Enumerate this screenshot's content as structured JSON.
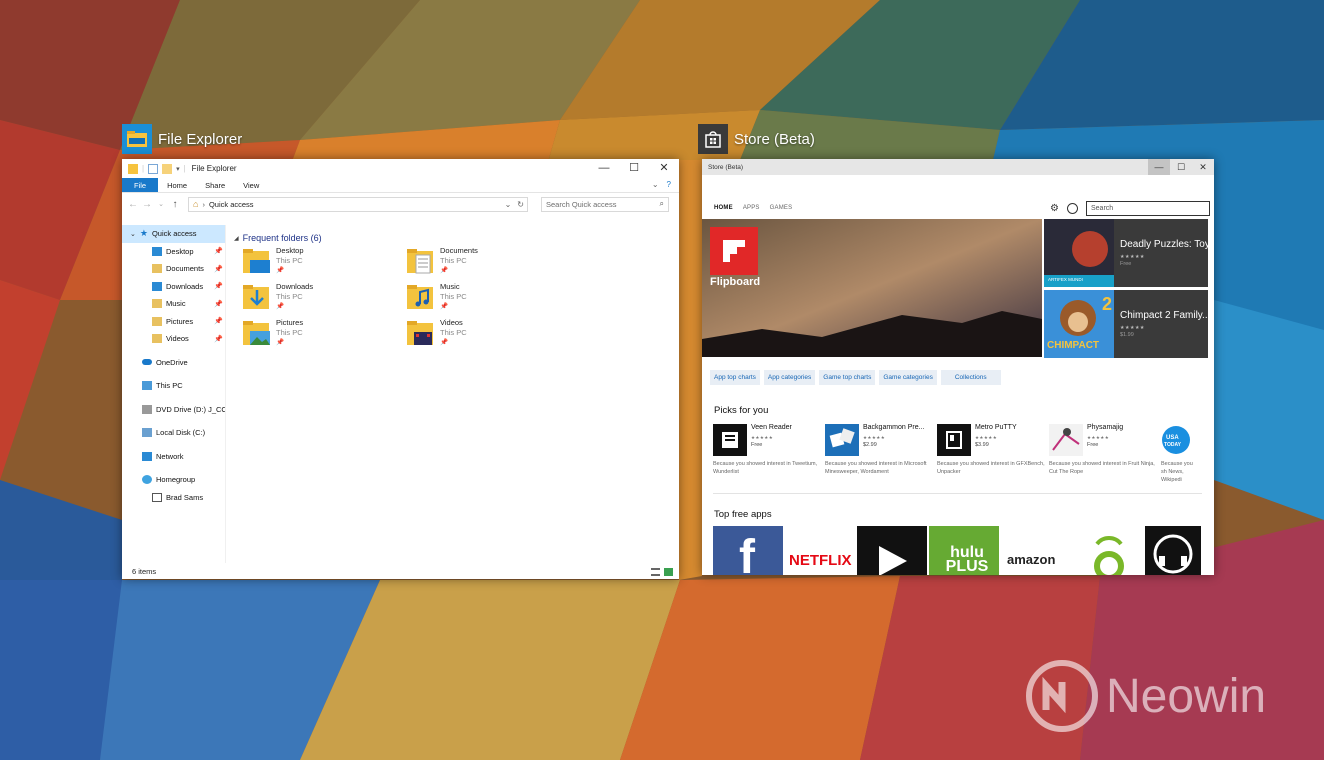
{
  "explorer": {
    "thumb_title": "File Explorer",
    "window_title": "File Explorer",
    "ribbon_tabs": [
      "File",
      "Home",
      "Share",
      "View"
    ],
    "address": "Quick access",
    "search_placeholder": "Search Quick access",
    "nav_items": [
      {
        "label": "Quick access",
        "icon": "star-icon",
        "pinned": false
      },
      {
        "label": "Desktop",
        "icon": "desktop-folder-icon",
        "pinned": true
      },
      {
        "label": "Documents",
        "icon": "documents-folder-icon",
        "pinned": true
      },
      {
        "label": "Downloads",
        "icon": "downloads-folder-icon",
        "pinned": true
      },
      {
        "label": "Music",
        "icon": "music-folder-icon",
        "pinned": true
      },
      {
        "label": "Pictures",
        "icon": "pictures-folder-icon",
        "pinned": true
      },
      {
        "label": "Videos",
        "icon": "videos-folder-icon",
        "pinned": true
      },
      {
        "label": "OneDrive",
        "icon": "onedrive-icon",
        "pinned": false
      },
      {
        "label": "This PC",
        "icon": "this-pc-icon",
        "pinned": false
      },
      {
        "label": "DVD Drive (D:) J_CCS",
        "icon": "dvd-drive-icon",
        "pinned": false
      },
      {
        "label": "Local Disk (C:)",
        "icon": "local-disk-icon",
        "pinned": false
      },
      {
        "label": "Network",
        "icon": "network-icon",
        "pinned": false
      },
      {
        "label": "Homegroup",
        "icon": "homegroup-icon",
        "pinned": false
      },
      {
        "label": "Brad Sams",
        "icon": "user-icon",
        "pinned": false
      }
    ],
    "group_title": "Frequent folders (6)",
    "folders": [
      {
        "name": "Desktop",
        "location": "This PC",
        "icon": "desktop"
      },
      {
        "name": "Documents",
        "location": "This PC",
        "icon": "documents"
      },
      {
        "name": "Downloads",
        "location": "This PC",
        "icon": "downloads"
      },
      {
        "name": "Music",
        "location": "This PC",
        "icon": "music"
      },
      {
        "name": "Pictures",
        "location": "This PC",
        "icon": "pictures"
      },
      {
        "name": "Videos",
        "location": "This PC",
        "icon": "videos"
      }
    ],
    "status": "6 items"
  },
  "store": {
    "thumb_title": "Store (Beta)",
    "window_title": "Store (Beta)",
    "nav_tabs": [
      "HOME",
      "APPS",
      "GAMES"
    ],
    "search_placeholder": "Search",
    "hero_label": "Flipboard",
    "featured": [
      {
        "name": "Deadly Puzzles: Toy...",
        "stars": "★★★★★",
        "price": "Free",
        "art_caption": "ARTIFEX MUNDI"
      },
      {
        "name": "Chimpact 2 Family...",
        "stars": "★★★★★",
        "price": "$1.99",
        "art_caption": "CHIMPACT"
      }
    ],
    "links": [
      "App top charts",
      "App categories",
      "Game top charts",
      "Game categories",
      "Collections"
    ],
    "picks_title": "Picks for you",
    "picks": [
      {
        "name": "Veen Reader",
        "stars": "★★★★★",
        "price": "Free",
        "reason": "Because you showed interest in Tweetium, Wunderlist"
      },
      {
        "name": "Backgammon Pre...",
        "stars": "★★★★★",
        "price": "$2.99",
        "reason": "Because you showed interest in Microsoft Minesweeper, Wordament"
      },
      {
        "name": "Metro PuTTY",
        "stars": "★★★★★",
        "price": "$3.99",
        "reason": "Because you showed interest in GFXBench, Unpacker"
      },
      {
        "name": "Physamajig",
        "stars": "★★★★★",
        "price": "Free",
        "reason": "Because you showed interest in Fruit Ninja, Cut The Rope"
      },
      {
        "name": "U",
        "stars": "★★★★★",
        "price": "F",
        "reason": "Because you sh News, Wikipedi"
      }
    ],
    "top_free_title": "Top free apps",
    "top_free": [
      {
        "name": "Facebook",
        "label": "f"
      },
      {
        "name": "Netflix",
        "label": "NETFLIX"
      },
      {
        "name": "Video player",
        "label": ""
      },
      {
        "name": "Hulu Plus",
        "label": "hulu PLUS"
      },
      {
        "name": "Amazon",
        "label": "amazon"
      },
      {
        "name": "Podcast app",
        "label": ""
      },
      {
        "name": "Headphones app",
        "label": ""
      }
    ]
  },
  "watermark": "Neowin",
  "colors": {
    "accent": "#1979ca",
    "store_link": "#1766b5",
    "folder_yellow": "#f7c948"
  }
}
